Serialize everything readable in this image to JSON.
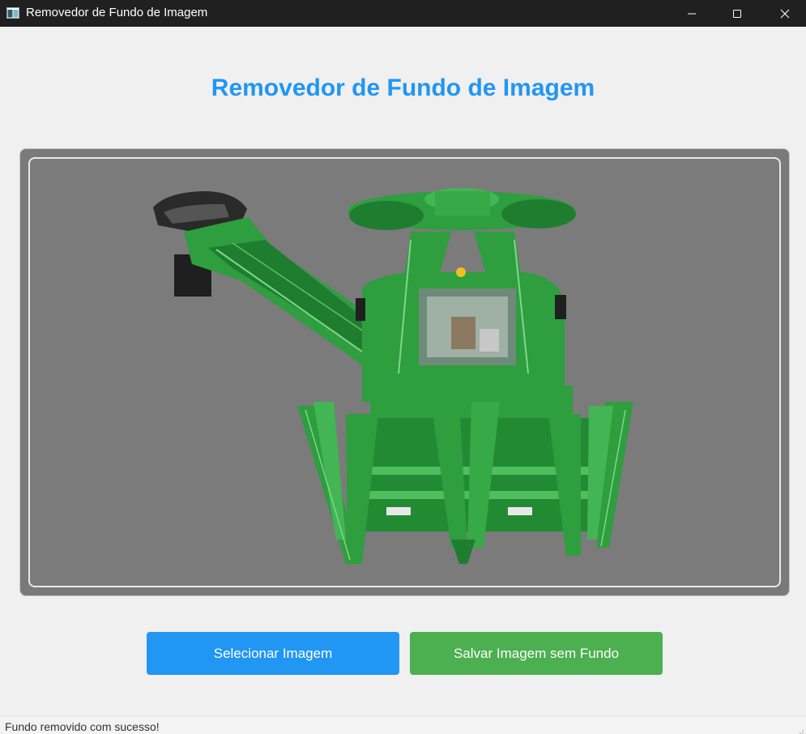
{
  "window": {
    "title": "Removedor de Fundo de Imagem",
    "app_icon": "app-window-icon",
    "controls": {
      "minimize_icon": "minimize-icon",
      "maximize_icon": "maximize-icon",
      "close_icon": "close-icon"
    }
  },
  "main": {
    "heading": "Removedor de Fundo de Imagem",
    "image_preview": {
      "subject": "green-harvester-machine"
    },
    "buttons": {
      "select_label": "Selecionar Imagem",
      "save_label": "Salvar Imagem sem Fundo"
    }
  },
  "status": {
    "message": "Fundo removido com sucesso!"
  },
  "colors": {
    "titlebar": "#202020",
    "heading": "#2196f3",
    "select_button": "#2196f3",
    "save_button": "#4caf50",
    "preview_bg": "#7b7b7b",
    "machine_green": "#2e9e3f"
  }
}
